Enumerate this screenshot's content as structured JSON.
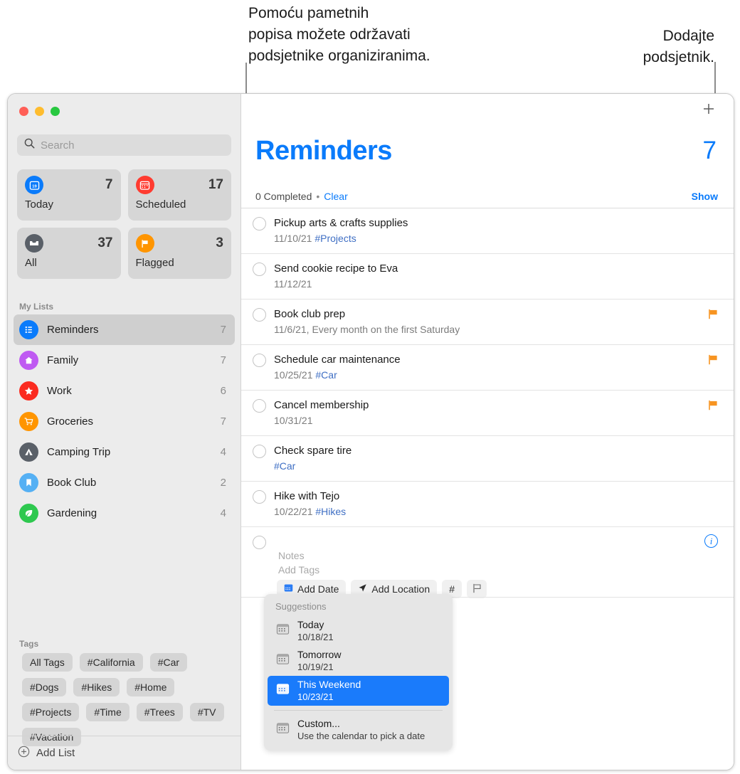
{
  "callouts": {
    "left": "Pomoću pametnih\npopisa možete održavati\npodsjetnike organiziranima.",
    "right": "Dodajte\npodsjetnik."
  },
  "sidebar": {
    "search": {
      "placeholder": "Search",
      "value": ""
    },
    "smart_lists": [
      {
        "label": "Today",
        "count": "7",
        "icon": "calendar-today-icon",
        "color": "#0a7bfb"
      },
      {
        "label": "Scheduled",
        "count": "17",
        "icon": "calendar-icon",
        "color": "#ff3b30"
      },
      {
        "label": "All",
        "count": "37",
        "icon": "inbox-icon",
        "color": "#5a6068"
      },
      {
        "label": "Flagged",
        "count": "3",
        "icon": "flag-icon",
        "color": "#ff9500"
      }
    ],
    "my_lists_header": "My Lists",
    "lists": [
      {
        "label": "Reminders",
        "count": "7",
        "icon": "list-bullet-icon",
        "color": "#0a7bfb",
        "selected": true
      },
      {
        "label": "Family",
        "count": "7",
        "icon": "house-icon",
        "color": "#bf5af2",
        "selected": false
      },
      {
        "label": "Work",
        "count": "6",
        "icon": "star-icon",
        "color": "#fb2b20",
        "selected": false
      },
      {
        "label": "Groceries",
        "count": "7",
        "icon": "cart-icon",
        "color": "#ff9500",
        "selected": false
      },
      {
        "label": "Camping Trip",
        "count": "4",
        "icon": "tent-icon",
        "color": "#5a6068",
        "selected": false
      },
      {
        "label": "Book Club",
        "count": "2",
        "icon": "bookmark-icon",
        "color": "#55b0f4",
        "selected": false
      },
      {
        "label": "Gardening",
        "count": "4",
        "icon": "leaf-icon",
        "color": "#2ec84f",
        "selected": false
      }
    ],
    "tags_header": "Tags",
    "tags": [
      "All Tags",
      "#California",
      "#Car",
      "#Dogs",
      "#Hikes",
      "#Home",
      "#Projects",
      "#Time",
      "#Trees",
      "#TV",
      "#Vacation"
    ],
    "add_list_label": "Add List"
  },
  "main": {
    "title": "Reminders",
    "count": "7",
    "accent_color": "#0a7bfb",
    "completed_text": "0 Completed",
    "separator": "•",
    "clear_label": "Clear",
    "show_label": "Show",
    "add_reminder_icon": "plus-icon",
    "reminders": [
      {
        "title": "Pickup arts & crafts supplies",
        "date": "11/10/21",
        "tag": "#Projects",
        "flagged": false
      },
      {
        "title": "Send cookie recipe to Eva",
        "date": "11/12/21",
        "tag": "",
        "flagged": false
      },
      {
        "title": "Book club prep",
        "date": "11/6/21, Every month on the first Saturday",
        "tag": "",
        "flagged": true
      },
      {
        "title": "Schedule car maintenance",
        "date": "10/25/21",
        "tag": "#Car",
        "flagged": true
      },
      {
        "title": "Cancel membership",
        "date": "10/31/21",
        "tag": "",
        "flagged": true
      },
      {
        "title": "Check spare tire",
        "date": "",
        "tag": "#Car",
        "flagged": false
      },
      {
        "title": "Hike with Tejo",
        "date": "10/22/21",
        "tag": "#Hikes",
        "flagged": false
      }
    ],
    "editor": {
      "notes_placeholder": "Notes",
      "tags_placeholder": "Add Tags",
      "info_icon": "info-circle-icon",
      "toolbar": [
        {
          "label": "Add Date",
          "icon": "calendar-icon"
        },
        {
          "label": "Add Location",
          "icon": "location-arrow-icon"
        },
        {
          "label": "#",
          "icon": "hashtag-icon"
        },
        {
          "label": "",
          "icon": "flag-outline-icon"
        }
      ]
    },
    "suggestions": {
      "title": "Suggestions",
      "items": [
        {
          "label": "Today",
          "sub": "10/18/21",
          "highlight": false,
          "icon": "calendar-icon"
        },
        {
          "label": "Tomorrow",
          "sub": "10/19/21",
          "highlight": false,
          "icon": "calendar-icon"
        },
        {
          "label": "This Weekend",
          "sub": "10/23/21",
          "highlight": true,
          "icon": "calendar-icon"
        },
        {
          "label": "Custom...",
          "sub": "Use the calendar to pick a date",
          "highlight": false,
          "icon": "calendar-icon"
        }
      ]
    }
  }
}
